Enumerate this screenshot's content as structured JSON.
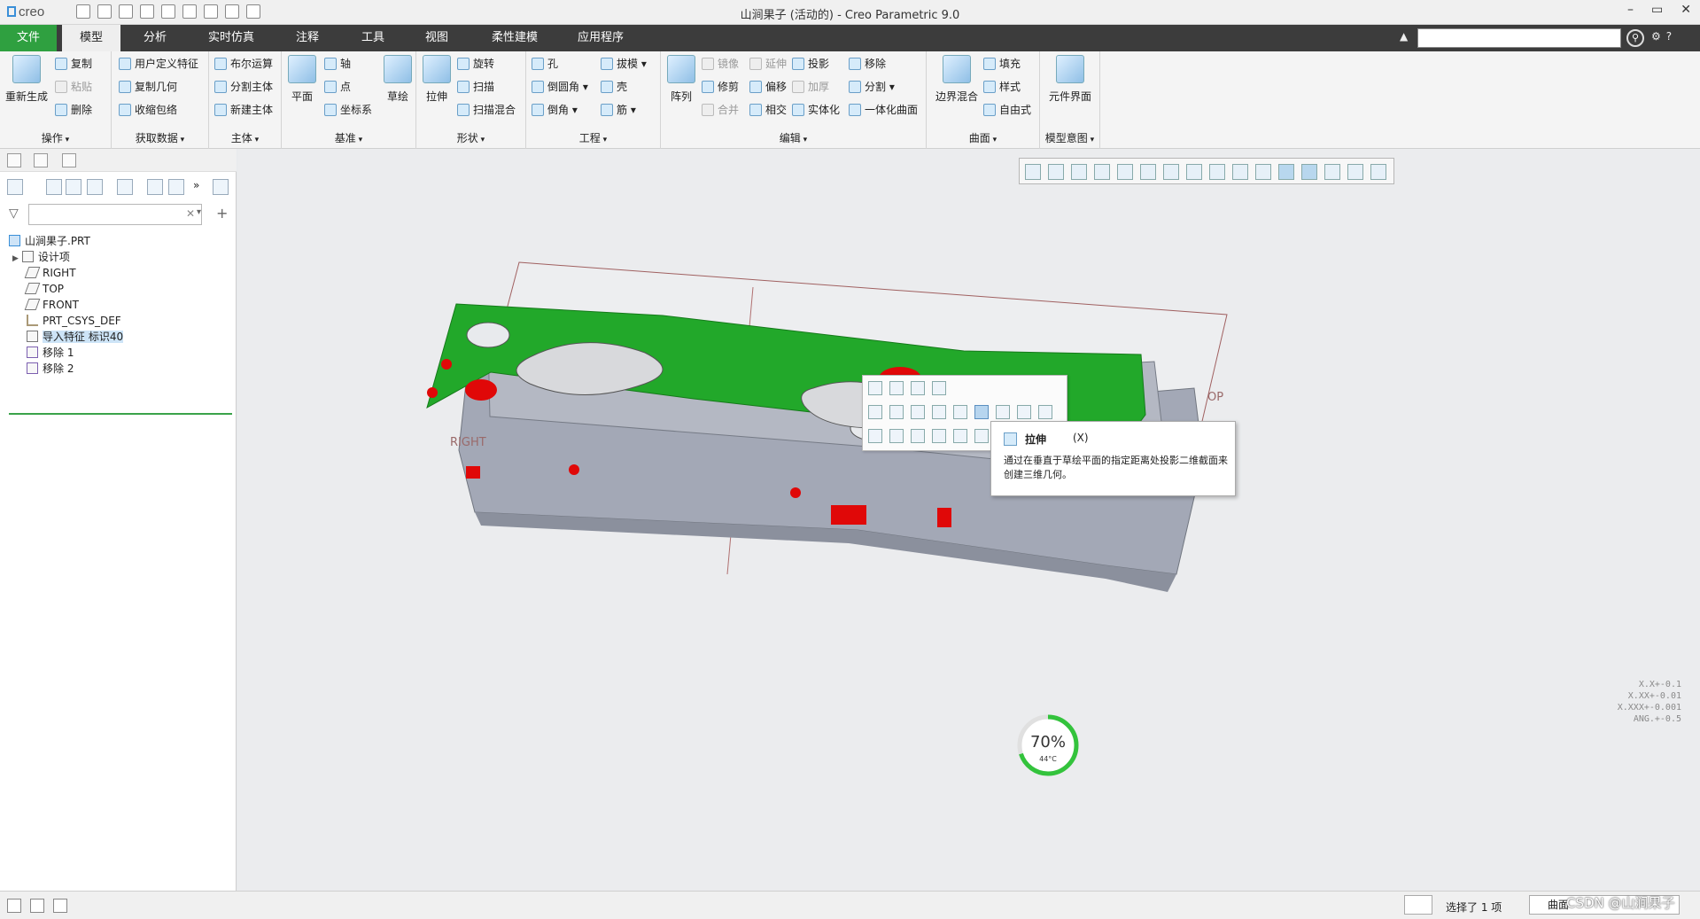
{
  "app": {
    "logo": "creo",
    "title": "山涧果子 (活动的) - Creo Parametric 9.0",
    "win_min": "–",
    "win_max": "▭",
    "win_close": "✕"
  },
  "menu": {
    "tabs": [
      "文件",
      "模型",
      "分析",
      "实时仿真",
      "注释",
      "工具",
      "视图",
      "柔性建模",
      "应用程序"
    ],
    "active": "模型",
    "help": "?"
  },
  "ribbon": {
    "groups": {
      "operations": {
        "label": "操作",
        "regen": "重新生成",
        "copy": "复制",
        "paste": "粘贴",
        "delete": "删除"
      },
      "getdata": {
        "label": "获取数据",
        "udf": "用户定义特征",
        "copygeom": "复制几何",
        "shrinkwrap": "收缩包络"
      },
      "body": {
        "label": "主体",
        "boolean": "布尔运算",
        "split": "分割主体",
        "newbody": "新建主体"
      },
      "datum": {
        "label": "基准",
        "plane": "平面",
        "axis": "轴",
        "point": "点",
        "csys": "坐标系",
        "sketch": "草绘"
      },
      "shapes": {
        "label": "形状",
        "extrude": "拉伸",
        "revolve": "旋转",
        "sweep": "扫描",
        "sweptblend": "扫描混合"
      },
      "engineering": {
        "label": "工程",
        "hole": "孔",
        "round": "倒圆角",
        "chamfer": "倒角",
        "draft": "拔模",
        "shell": "壳",
        "rib": "筋"
      },
      "editing": {
        "label": "编辑",
        "pattern": "阵列",
        "mirror": "镜像",
        "trim": "修剪",
        "merge": "合并",
        "extend": "延伸",
        "offset": "偏移",
        "intersect": "相交",
        "project": "投影",
        "thicken": "加厚",
        "solidify": "实体化",
        "remove": "移除",
        "split": "分割",
        "unify": "一体化曲面"
      },
      "surfaces": {
        "label": "曲面",
        "boundary": "边界混合",
        "fill": "填充",
        "style": "样式",
        "freestyle": "自由式"
      },
      "intent": {
        "label": "模型意图",
        "component": "元件界面"
      }
    }
  },
  "tree": {
    "items": [
      {
        "label": "山涧果子.PRT",
        "icon": "part-icon"
      },
      {
        "label": "设计项",
        "icon": "design-items-icon"
      },
      {
        "label": "RIGHT",
        "icon": "datum-plane-icon"
      },
      {
        "label": "TOP",
        "icon": "datum-plane-icon"
      },
      {
        "label": "FRONT",
        "icon": "datum-plane-icon"
      },
      {
        "label": "PRT_CSYS_DEF",
        "icon": "csys-icon"
      },
      {
        "label": "导入特征 标识40",
        "icon": "import-feature-icon",
        "selected": true
      },
      {
        "label": "移除 1",
        "icon": "remove-feature-icon"
      },
      {
        "label": "移除 2",
        "icon": "remove-feature-icon"
      }
    ]
  },
  "viewport": {
    "datum_labels": {
      "right": "RIGHT",
      "top": "OP"
    },
    "tooltip": {
      "title": "拉伸",
      "key": "(X)",
      "desc": "通过在垂直于草绘平面的指定距离处投影二维截面来创建三维几何。"
    },
    "tolerances": [
      "X.X+-0.1",
      "X.XX+-0.01",
      "X.XXX+-0.001",
      "ANG.+-0.5"
    ],
    "gauge": {
      "percent": "70%",
      "temp": "44°C",
      "fraction": 0.7
    }
  },
  "status": {
    "selected": "选择了 1 项",
    "filter": "曲面"
  },
  "watermark": "CSDN @山涧果子",
  "colors": {
    "accent_green": "#2fa040",
    "top_face": "#22a82a",
    "body_gray": "#a3a8b6",
    "hole_red": "#e00808"
  }
}
